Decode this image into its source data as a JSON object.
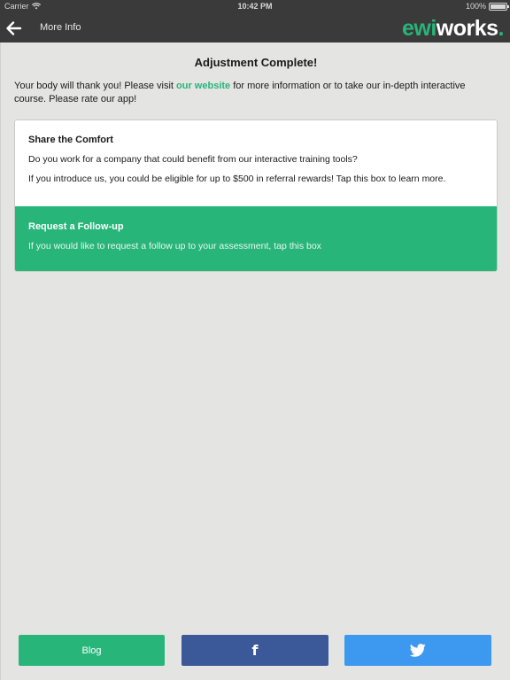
{
  "status_bar": {
    "carrier": "Carrier",
    "time": "10:42 PM",
    "battery": "100%"
  },
  "nav": {
    "title": "More Info",
    "logo": {
      "part1": "ewi",
      "part2": "works",
      "part3": "."
    },
    "back_icon": "arrow-left-icon"
  },
  "main": {
    "heading": "Adjustment Complete!",
    "intro_before": "Your body will thank you! Please visit ",
    "intro_link": "our website",
    "intro_after": " for more information or to take our in-depth interactive course. Please rate our app!"
  },
  "share_card": {
    "title": "Share the Comfort",
    "line1": "Do you work for a company that could benefit from our interactive training tools?",
    "line2": "If you introduce us, you could be eligible for up to $500 in referral rewards! Tap this box to learn more."
  },
  "followup_card": {
    "title": "Request a Follow-up",
    "line1": "If you would like to request a follow up to your assessment, tap this box"
  },
  "footer": {
    "blog_label": "Blog",
    "facebook_glyph": "f",
    "facebook_icon": "facebook-icon",
    "twitter_icon": "twitter-icon"
  },
  "colors": {
    "accent": "#27b57a",
    "nav_bg": "#3a3a3a",
    "page_bg": "#e4e4e2",
    "facebook": "#3b5998",
    "twitter": "#3d99f0"
  }
}
